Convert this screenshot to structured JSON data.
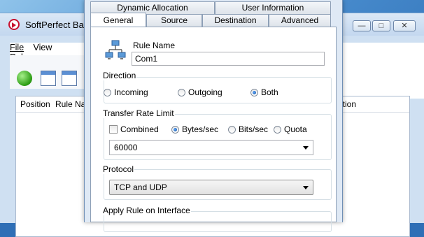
{
  "background_app": {
    "title": "SoftPerfect Band",
    "menu": [
      "File",
      "View",
      "Rules"
    ],
    "list_columns": [
      "Position",
      "Rule Na",
      "ation"
    ]
  },
  "dialog": {
    "tabs_top": [
      "Dynamic Allocation",
      "User Information"
    ],
    "tabs_bottom": [
      "General",
      "Source",
      "Destination",
      "Advanced"
    ],
    "active_tab": "General",
    "rule_name": {
      "label": "Rule Name",
      "value": "Com1"
    },
    "direction": {
      "label": "Direction",
      "options": [
        "Incoming",
        "Outgoing",
        "Both"
      ],
      "selected": "Both"
    },
    "transfer_rate": {
      "label": "Transfer Rate Limit",
      "combined_label": "Combined",
      "combined_checked": false,
      "units": [
        "Bytes/sec",
        "Bits/sec",
        "Quota"
      ],
      "selected_unit": "Bytes/sec",
      "value": "60000"
    },
    "protocol": {
      "label": "Protocol",
      "value": "TCP and UDP"
    },
    "interface": {
      "label": "Apply Rule on Interface"
    }
  },
  "colors": {
    "accent": "#124f98",
    "dialog_bg": "#dfe9f5",
    "desktop": "#2f6fb6"
  }
}
